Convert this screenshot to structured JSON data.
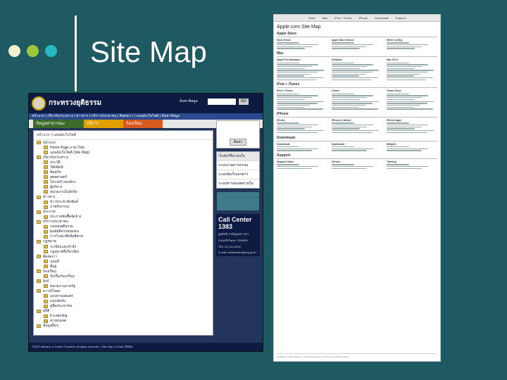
{
  "slide": {
    "title": "Site Map",
    "dot_colors": [
      "#f2f2d0",
      "#9cc93a",
      "#24b9c0"
    ]
  },
  "thai_site": {
    "site_name": "กระทรวงยุติธรรม",
    "search_label": "ค้นหาข้อมูล",
    "search_button": "GO",
    "nav_text": "หน้าแรก | เกี่ยวกับกระทรวง | ข่าวสาร | บริการประชาชน | ติดต่อเรา | แผนผังเว็บไซต์ | ค้นหาข้อมูล",
    "bar": [
      "ข้อมูลสาธารณะ",
      "บริการ",
      "ร้องเรียน"
    ],
    "bar_colors": [
      "#3f6b2a",
      "#e0a000",
      "#d85a20"
    ],
    "breadcrumb": "หน้าแรก > แผนผังเว็บไซต์",
    "tree": [
      "หน้าแรก",
      "Home Page ภาษาไทย",
      "แผนผังเว็บไซต์ (Site Map)",
      "เกี่ยวกับกระทรวง",
      "ประวัติ",
      "วิสัยทัศน์",
      "พันธกิจ",
      "ยุทธศาสตร์",
      "โครงสร้างองค์กร",
      "ผู้บริหาร",
      "หน่วยงานในสังกัด",
      "ข่าวสาร",
      "ข่าวประชาสัมพันธ์",
      "ภาพกิจกรรม",
      "ประกาศ",
      "ประกาศจัดซื้อจัดจ้าง",
      "บริการประชาชน",
      "กองทุนยุติธรรม",
      "ศูนย์ยุติธรรมชุมชน",
      "การไกล่เกลี่ยข้อพิพาท",
      "กฎหมาย",
      "ระเบียบและคำสั่ง",
      "กฎหมายที่เกี่ยวข้อง",
      "ติดต่อเรา",
      "แผนที่",
      "ที่อยู่",
      "ร้องเรียน",
      "รับเรื่องร้องเรียน",
      "ลิงก์",
      "หน่วยงานภาครัฐ",
      "ดาวน์โหลด",
      "เอกสารเผยแพร่",
      "แบบฟอร์ม",
      "คู่มือประชาชน",
      "สถิติ",
      "E-Learning",
      "สารสนเทศ",
      "ข้อมูลอื่นๆ"
    ],
    "sidebar_search_btn": "ค้นหา",
    "sidebar_box_head": "เว็บลิงก์ที่น่าสนใจ",
    "sidebar_items": [
      "ระบบงานสารบรรณ",
      "ระบบจัดเก็บเอกสาร",
      "ระบบสารสนเทศภายใน"
    ],
    "call_center_title": "Call Center 1383",
    "call_center_lines": [
      "ศูนย์บริการข้อมูลข่าวสาร",
      "ถนนแจ้งวัฒนะ กรุงเทพฯ",
      "โทร. 02-141-5100",
      "E-mail: webmaster@moj.go.th"
    ],
    "footer": "©2007 Ministry of Justice Thailand. All rights reserved. | Site Map | E-Mail | ติดต่อ"
  },
  "apple_site": {
    "nav": [
      "Store",
      "Mac",
      "iPod + iTunes",
      "iPhone",
      "Downloads",
      "Support"
    ],
    "title": "Apple.com Site Map",
    "sections": [
      {
        "head": "Apple Store",
        "cols": [
          "Store Home",
          "Apple Store Stores",
          "Where to Buy"
        ],
        "lines": 4
      },
      {
        "head": "Mac",
        "cols": [
          "Apple Pro Hardware",
          "Software",
          "Mac OS X"
        ],
        "lines": 10
      },
      {
        "head": "iPod + iTunes",
        "cols": [
          "iPod + iTunes",
          "iTunes",
          "iTunes Store"
        ],
        "lines": 9
      },
      {
        "head": "iPhone",
        "cols": [
          "iPhone",
          "iPhone in Action",
          "iPhone Apps"
        ],
        "lines": 6
      },
      {
        "head": "Downloads",
        "cols": [
          "Downloads",
          "Dashboard",
          "Widgets"
        ],
        "lines": 3
      },
      {
        "head": "Support",
        "cols": [
          "Support Home",
          "Service",
          "Training"
        ],
        "lines": 3
      }
    ],
    "footer": "Copyright © 2007 Apple Inc. All rights reserved. Terms of Use | Privacy Policy"
  }
}
